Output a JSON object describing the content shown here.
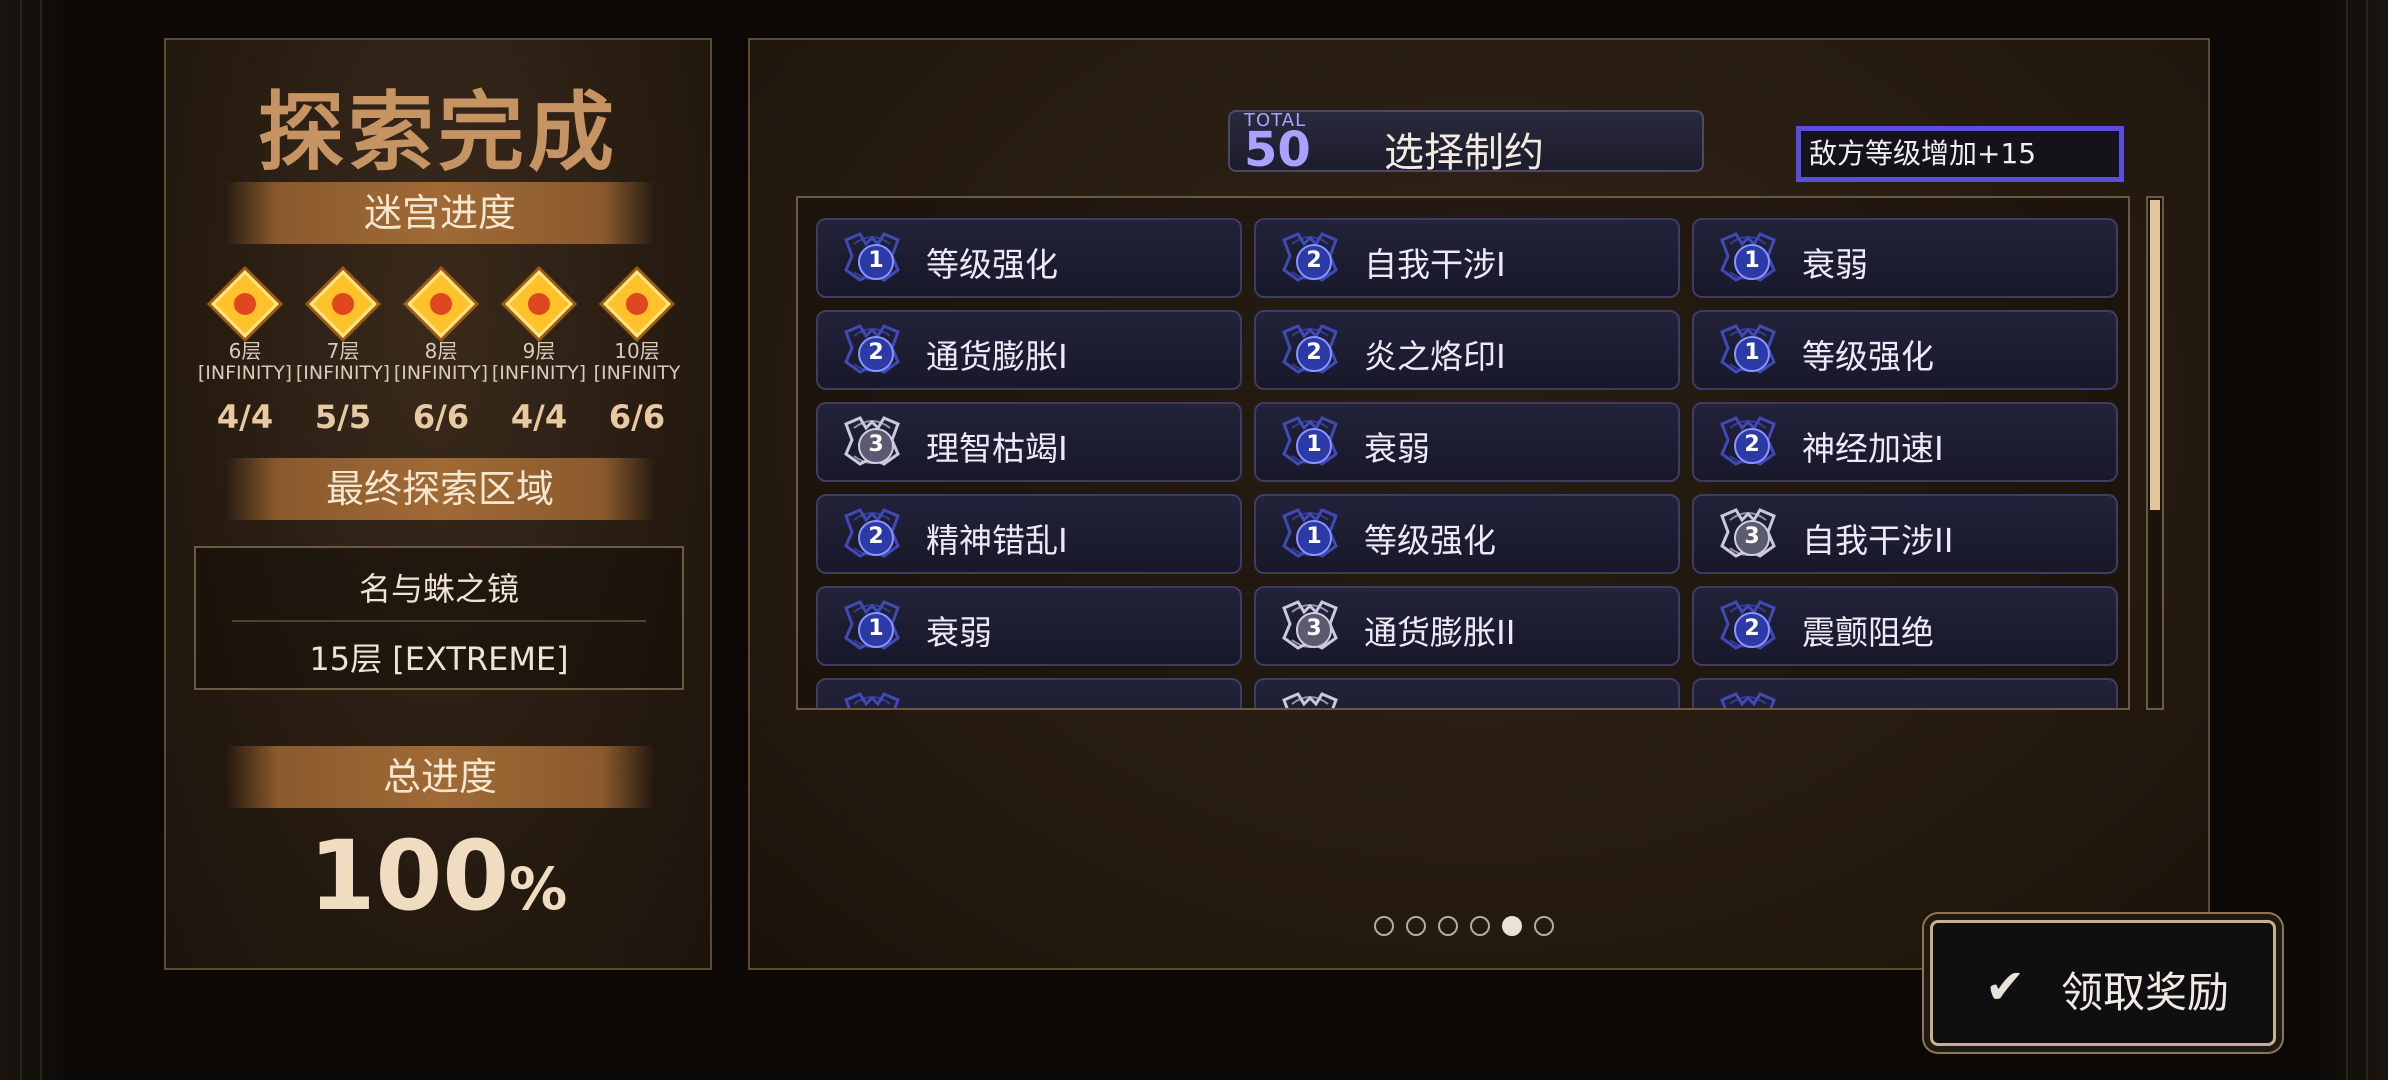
{
  "left": {
    "title": "探索完成",
    "progress_label": "迷宫进度",
    "floors": [
      {
        "floor": "6层",
        "level": "[INFINITY]",
        "count": "4/4"
      },
      {
        "floor": "7层",
        "level": "[INFINITY]",
        "count": "5/5"
      },
      {
        "floor": "8层",
        "level": "[INFINITY]",
        "count": "6/6"
      },
      {
        "floor": "9层",
        "level": "[INFINITY]",
        "count": "4/4"
      },
      {
        "floor": "10层",
        "level": "[INFINITY",
        "count": "6/6"
      }
    ],
    "final_area_label": "最终探索区域",
    "final_area_name": "名与蛛之镜",
    "final_area_floor": "15层 [EXTREME]",
    "total_label": "总进度",
    "total_value": "100",
    "total_unit": "%"
  },
  "right": {
    "total_caption": "TOTAL",
    "total_value": "50",
    "select_label": "选择制约",
    "enemy_level": "敌方等级增加+15",
    "cards": [
      {
        "level": "1",
        "label": "等级强化"
      },
      {
        "level": "2",
        "label": "自我干涉I"
      },
      {
        "level": "1",
        "label": "衰弱"
      },
      {
        "level": "2",
        "label": "通货膨胀I"
      },
      {
        "level": "2",
        "label": "炎之烙印I"
      },
      {
        "level": "1",
        "label": "等级强化"
      },
      {
        "level": "3",
        "label": "理智枯竭I"
      },
      {
        "level": "1",
        "label": "衰弱"
      },
      {
        "level": "2",
        "label": "神经加速I"
      },
      {
        "level": "2",
        "label": "精神错乱I"
      },
      {
        "level": "1",
        "label": "等级强化"
      },
      {
        "level": "3",
        "label": "自我干涉II"
      },
      {
        "level": "1",
        "label": "衰弱"
      },
      {
        "level": "3",
        "label": "通货膨胀II"
      },
      {
        "level": "2",
        "label": "震颤阻绝"
      }
    ],
    "page_dots": {
      "count": 6,
      "active_index": 4
    },
    "claim_label": "领取奖励",
    "claim_icon": "check-icon"
  },
  "colors": {
    "accent_purple": "#5a4ee0",
    "gold": "#c69463",
    "card_bg": "#1e1e34"
  }
}
